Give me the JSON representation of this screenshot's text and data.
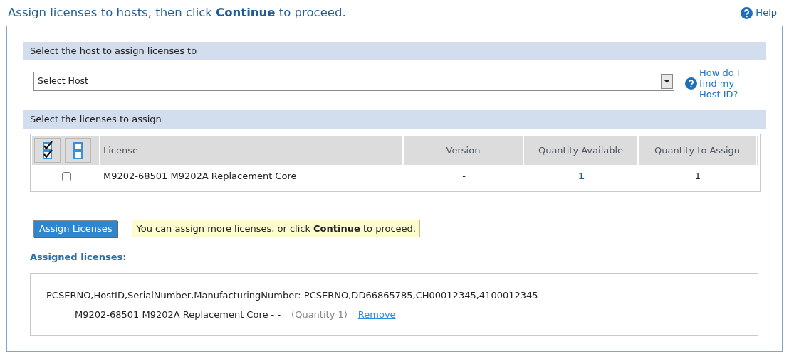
{
  "header": {
    "title": "Assign licenses to hosts, then click **Continue** to proceed.",
    "help": "Help"
  },
  "host_section": {
    "title": "Select the host to assign licenses to",
    "select": {
      "value": "Select Host"
    },
    "help_link": "How do I find my Host ID?"
  },
  "licenses_section": {
    "title": "Select the licenses to assign",
    "table": {
      "columns": [
        "License",
        "Version",
        "Quantity Available",
        "Quantity to Assign"
      ],
      "rows": [
        {
          "checked": false,
          "license": "M9202-68501 M9202A Replacement Core",
          "version": "-",
          "quantity_available": "1",
          "quantity_to_assign": "1"
        }
      ]
    }
  },
  "assign_button": "Assign Licenses",
  "notice": "You can assign more licenses, or click **Continue** to proceed.",
  "assigned": {
    "title": "Assigned licenses:",
    "host_line": "PCSERNO,HostID,SerialNumber,ManufacturingNumber: PCSERNO,DD66865785,CH00012345,4100012345",
    "items": [
      {
        "license": "M9202-68501 M9202A Replacement Core - -",
        "quantity": "(Quantity 1)",
        "action": "Remove"
      }
    ]
  }
}
